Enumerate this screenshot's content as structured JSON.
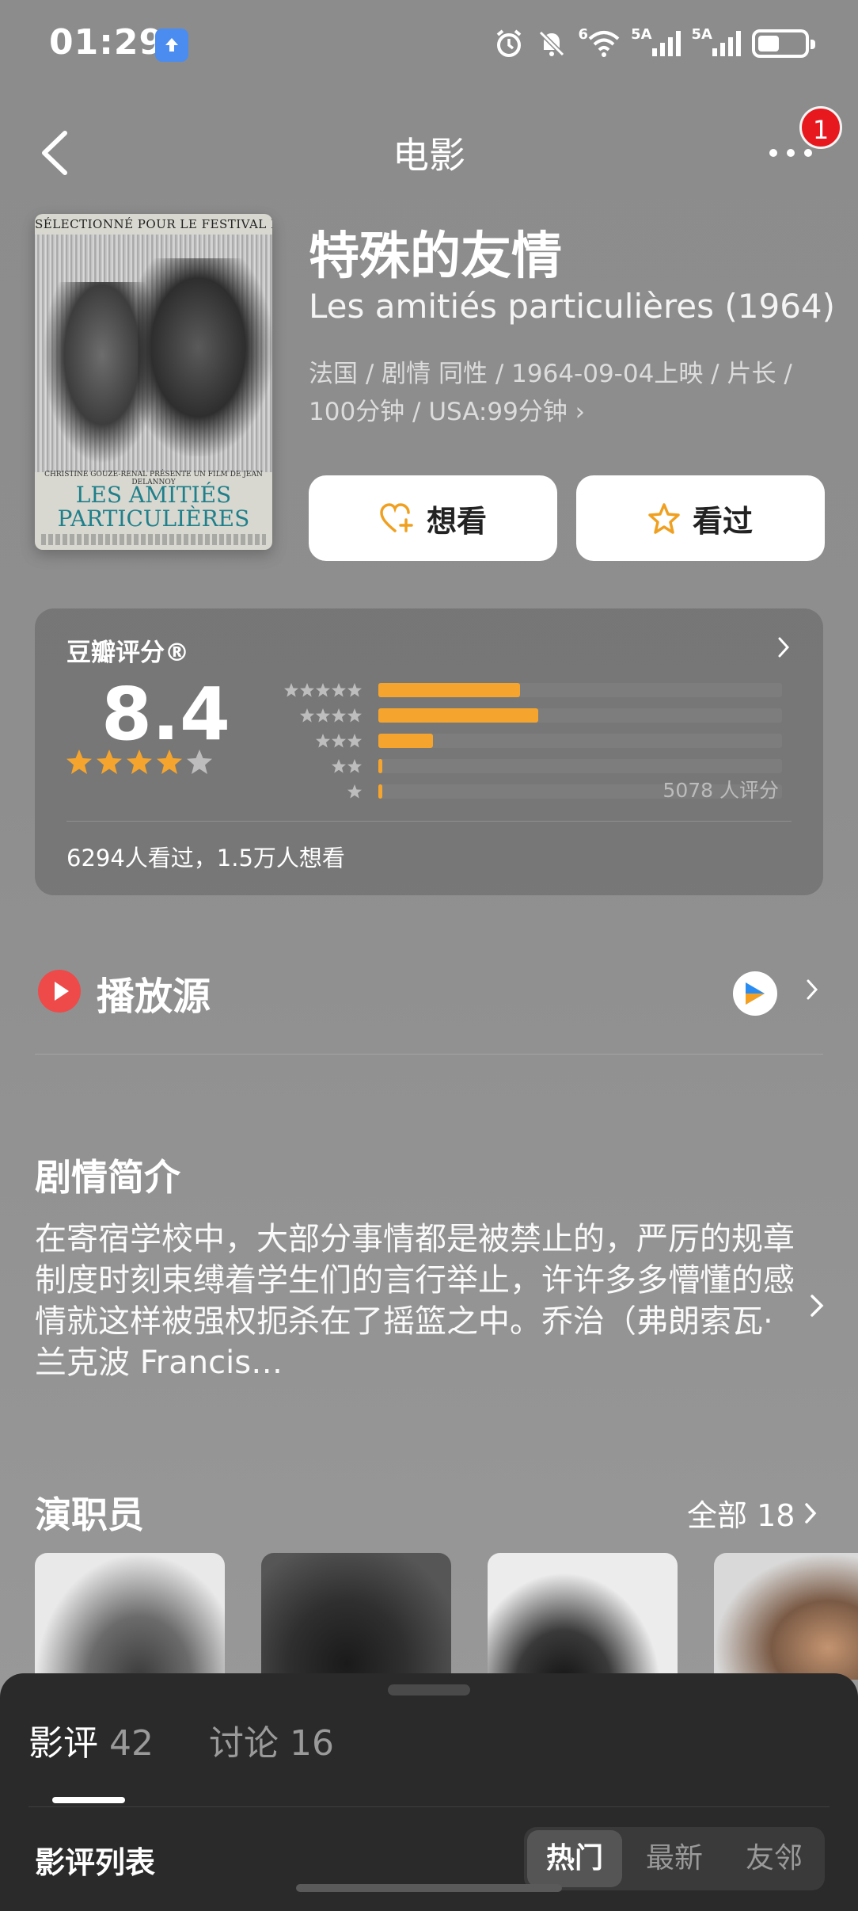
{
  "status_bar": {
    "time": "01:29",
    "network_label_1": "5A",
    "network_label_2": "5A",
    "wifi_label": "6"
  },
  "nav": {
    "title": "电影",
    "notification_count": "1"
  },
  "movie": {
    "title_cn": "特殊的友情",
    "title_original": "Les amitiés particulières (1964)",
    "meta": "法国 / 剧情 同性 / 1964-09-04上映 / 片长 / 100分钟 / USA:99分钟 ›",
    "poster": {
      "top_text": "SÉLECTIONNÉ POUR LE FESTIVAL DE VENISE",
      "credits": "CHRISTINE GOUZE-RENAL PRÉSENTE UN FILM DE JEAN DELANNOY",
      "title_line1": "LES AMITIÉS",
      "title_line2": "PARTICULIÈRES"
    },
    "want_label": "想看",
    "seen_label": "看过"
  },
  "rating": {
    "label": "豆瓣评分®",
    "score": "8.4",
    "stars": 4,
    "distribution": [
      0.39,
      0.44,
      0.15,
      0.01,
      0.01
    ],
    "count_label": "5078 人评分",
    "watch_stats": "6294人看过，1.5万人想看"
  },
  "play_source": {
    "label": "播放源"
  },
  "synopsis": {
    "title": "剧情简介",
    "text": "在寄宿学校中，大部分事情都是被禁止的，严厉的规章制度时刻束缚着学生们的言行举止，许许多多懵懂的感情就这样被强权扼杀在了摇篮之中。乔治（弗朗索瓦·兰克波 Francis…"
  },
  "cast": {
    "title": "演职员",
    "all_label": "全部 18"
  },
  "sheet": {
    "tab_reviews_label": "影评",
    "tab_reviews_count": "42",
    "tab_discuss_label": "讨论",
    "tab_discuss_count": "16",
    "list_title": "影评列表",
    "sort_options": [
      "热门",
      "最新",
      "友邻"
    ]
  },
  "colors": {
    "accent_star": "#f5a52d",
    "badge_red": "#e8181f",
    "play_red": "#ee4a4a"
  }
}
